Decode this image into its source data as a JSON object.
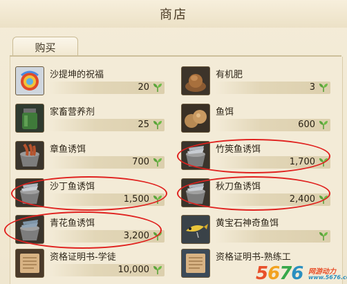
{
  "window": {
    "title": "商店"
  },
  "tabs": [
    {
      "label": "购买"
    }
  ],
  "colors": {
    "currency_leaf": "#5aa33a",
    "highlight_circle": "#e0221f"
  },
  "items": [
    {
      "name": "沙提坤的祝福",
      "price": "20",
      "icon": "blessing-orb-icon"
    },
    {
      "name": "有机肥",
      "price": "3",
      "icon": "fertilizer-pile-icon"
    },
    {
      "name": "家畜营养剂",
      "price": "25",
      "icon": "nutrient-jar-icon"
    },
    {
      "name": "鱼饵",
      "price": "600",
      "icon": "bait-balls-icon"
    },
    {
      "name": "章鱼诱饵",
      "price": "700",
      "icon": "octopus-bait-bucket-icon"
    },
    {
      "name": "竹筴鱼诱饵",
      "price": "1,700",
      "icon": "fish-bait-bucket-icon"
    },
    {
      "name": "沙丁鱼诱饵",
      "price": "1,500",
      "icon": "fish-bait-bucket-icon"
    },
    {
      "name": "秋刀鱼诱饵",
      "price": "2,400",
      "icon": "fish-bait-bucket-icon"
    },
    {
      "name": "青花鱼诱饵",
      "price": "3,200",
      "icon": "fish-bait-bucket-icon"
    },
    {
      "name": "黄宝石神奇鱼饵",
      "price": "",
      "icon": "lure-icon"
    },
    {
      "name": "资格证明书-学徒",
      "price": "10,000",
      "icon": "certificate-scroll-icon"
    },
    {
      "name": "资格证明书-熟练工",
      "price": "",
      "icon": "certificate-scroll-icon"
    }
  ],
  "watermark": {
    "number": "5676",
    "site": "网游动力",
    "site_small": "www.5676.com"
  }
}
